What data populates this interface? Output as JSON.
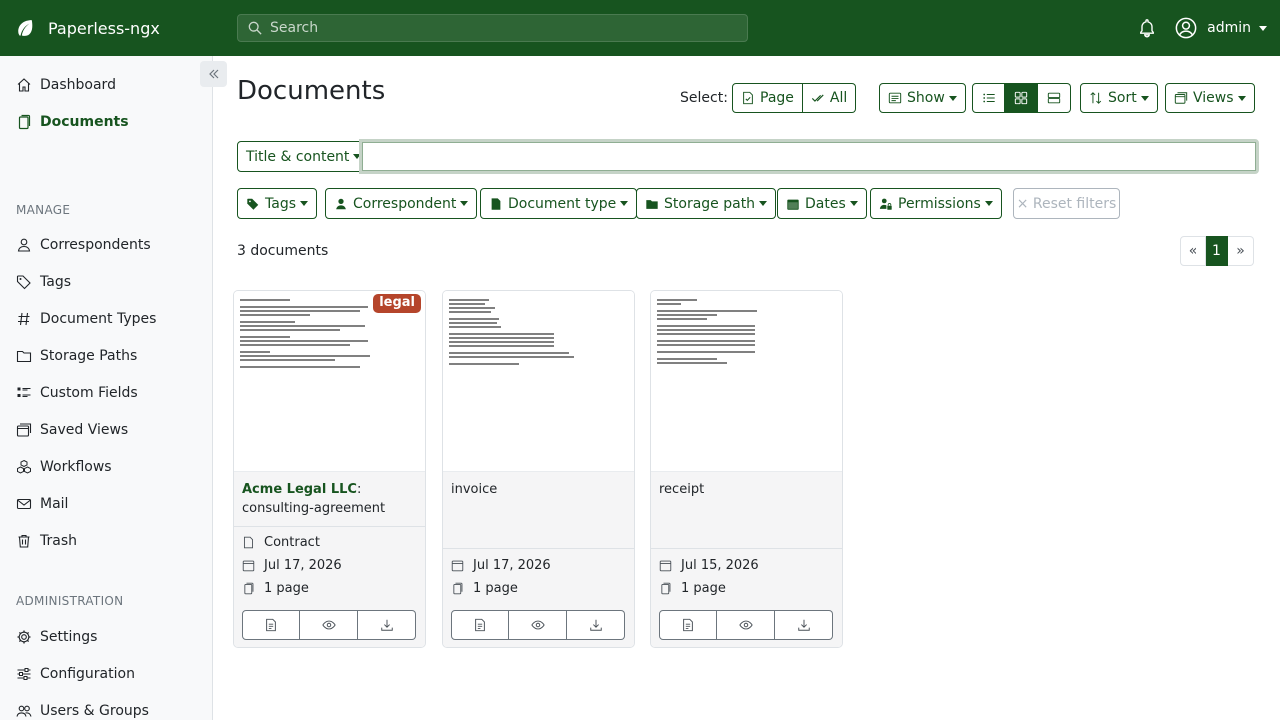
{
  "app": {
    "name": "Paperless-ngx"
  },
  "search": {
    "placeholder": "Search"
  },
  "user": {
    "name": "admin"
  },
  "sidebar": {
    "items": [
      {
        "label": "Dashboard",
        "icon": "house-icon"
      },
      {
        "label": "Documents",
        "icon": "files-icon",
        "active": true
      }
    ],
    "manage_heading": "MANAGE",
    "manage": [
      {
        "label": "Correspondents",
        "icon": "person-icon"
      },
      {
        "label": "Tags",
        "icon": "tag-icon"
      },
      {
        "label": "Document Types",
        "icon": "hash-icon"
      },
      {
        "label": "Storage Paths",
        "icon": "folder-icon"
      },
      {
        "label": "Custom Fields",
        "icon": "list-icon"
      },
      {
        "label": "Saved Views",
        "icon": "window-stack-icon"
      },
      {
        "label": "Workflows",
        "icon": "boxes-icon"
      },
      {
        "label": "Mail",
        "icon": "envelope-icon"
      },
      {
        "label": "Trash",
        "icon": "trash-icon"
      }
    ],
    "admin_heading": "ADMINISTRATION",
    "admin": [
      {
        "label": "Settings",
        "icon": "gear-icon"
      },
      {
        "label": "Configuration",
        "icon": "sliders-icon"
      },
      {
        "label": "Users & Groups",
        "icon": "people-icon"
      }
    ]
  },
  "page": {
    "title": "Documents",
    "select_label": "Select:",
    "select_page": "Page",
    "select_all": "All",
    "show_label": "Show",
    "sort_label": "Sort",
    "views_label": "Views",
    "text_filter_mode": "Title & content",
    "text_filter_value": "",
    "filters": {
      "tags": "Tags",
      "correspondent": "Correspondent",
      "document_type": "Document type",
      "storage_path": "Storage path",
      "dates": "Dates",
      "permissions": "Permissions",
      "reset": "× Reset filters"
    },
    "count": "3 documents",
    "pagination": {
      "prev": "«",
      "current": "1",
      "next": "»"
    }
  },
  "documents": [
    {
      "correspondent": "Acme Legal LLC",
      "title": "consulting-agreement",
      "tag": "legal",
      "document_type": "Contract",
      "date": "Jul 17, 2026",
      "pages": "1 page"
    },
    {
      "correspondent": "",
      "title": "invoice",
      "tag": "",
      "document_type": "",
      "date": "Jul 17, 2026",
      "pages": "1 page"
    },
    {
      "correspondent": "",
      "title": "receipt",
      "tag": "",
      "document_type": "",
      "date": "Jul 15, 2026",
      "pages": "1 page"
    }
  ],
  "colors": {
    "brand": "#17541f",
    "tag_legal": "#b5452b"
  }
}
